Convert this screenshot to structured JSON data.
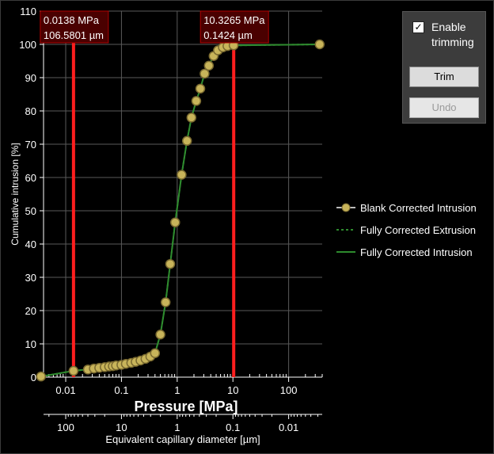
{
  "chart_data": {
    "type": "line",
    "xscale": "log",
    "xlabel": "Pressure [MPa]",
    "ylabel": "Cumulative intrusion [%]",
    "x2label": "Equivalent capillary diameter [µm]",
    "xlim": [
      0.004,
      400
    ],
    "ylim": [
      0,
      110
    ],
    "yticks": [
      0,
      10,
      20,
      30,
      40,
      50,
      60,
      70,
      80,
      90,
      100,
      110
    ],
    "xticks": [
      0.01,
      0.1,
      1,
      10,
      100
    ],
    "xtick_labels": [
      "0.01",
      "0.1",
      "1",
      "10",
      "100"
    ],
    "x2ticks": [
      100,
      10,
      1,
      0.1,
      0.01
    ],
    "x2tick_labels": [
      "100",
      "10",
      "1",
      "0.1",
      "0.01"
    ],
    "grid": true,
    "legend_position": "right",
    "series": [
      {
        "name": "Blank Corrected Intrusion",
        "marker": "circle",
        "color": "#c8b45a",
        "x": [
          0.0036,
          0.0138,
          0.025,
          0.032,
          0.04,
          0.05,
          0.06,
          0.07,
          0.08,
          0.1,
          0.12,
          0.15,
          0.18,
          0.22,
          0.27,
          0.33,
          0.4,
          0.5,
          0.62,
          0.75,
          0.92,
          1.2,
          1.5,
          1.8,
          2.2,
          2.6,
          3.1,
          3.7,
          4.5,
          5.4,
          6.6,
          8.0,
          10.3,
          360
        ],
        "y": [
          0.2,
          1.9,
          2.3,
          2.6,
          2.8,
          3.0,
          3.2,
          3.3,
          3.5,
          3.7,
          4.0,
          4.3,
          4.6,
          5.0,
          5.5,
          6.2,
          7.2,
          12.8,
          22.5,
          34.0,
          46.5,
          60.8,
          71.0,
          78.0,
          83.0,
          86.7,
          91.2,
          93.6,
          96.5,
          98.2,
          99.1,
          99.5,
          99.7,
          100.0
        ]
      },
      {
        "name": "Fully Corrected Extrusion",
        "style": "dotted",
        "color": "#2e8b2e",
        "x": [
          0.0036,
          0.0138,
          0.025,
          0.05,
          0.1,
          0.2,
          0.33,
          0.4,
          0.5,
          0.62,
          0.75,
          0.92,
          1.2,
          1.5,
          1.8,
          2.2,
          2.6,
          3.1,
          3.7,
          4.5,
          5.4,
          6.6,
          8.0,
          10.3,
          360
        ],
        "y": [
          0.2,
          1.9,
          2.3,
          3.0,
          3.7,
          4.8,
          6.2,
          7.2,
          12.8,
          22.5,
          34.0,
          46.5,
          60.8,
          71.0,
          78.0,
          83.0,
          86.7,
          91.2,
          93.6,
          96.5,
          98.2,
          99.1,
          99.5,
          99.7,
          100.0
        ]
      },
      {
        "name": "Fully Corrected Intrusion",
        "style": "solid",
        "color": "#2e8b2e",
        "x": [
          0.0036,
          0.0138,
          0.025,
          0.05,
          0.1,
          0.2,
          0.33,
          0.4,
          0.5,
          0.62,
          0.75,
          0.92,
          1.2,
          1.5,
          1.8,
          2.2,
          2.6,
          3.1,
          3.7,
          4.5,
          5.4,
          6.6,
          8.0,
          10.3,
          360
        ],
        "y": [
          0.2,
          1.9,
          2.3,
          3.0,
          3.7,
          4.8,
          6.2,
          7.2,
          12.8,
          22.5,
          34.0,
          46.5,
          60.8,
          71.0,
          78.0,
          83.0,
          86.7,
          91.2,
          93.6,
          96.5,
          98.2,
          99.1,
          99.5,
          99.7,
          100.0
        ]
      }
    ],
    "trim_markers": [
      {
        "x": 0.0138,
        "label1": "0.0138 MPa",
        "label2": "106.5801 µm",
        "color": "#ff1e1e"
      },
      {
        "x": 10.3265,
        "label1": "10.3265 MPa",
        "label2": "0.1424 µm",
        "color": "#ff1e1e"
      }
    ]
  },
  "panel": {
    "checkbox_label": "Enable trimming",
    "checked": true,
    "trim_label": "Trim",
    "undo_label": "Undo"
  }
}
